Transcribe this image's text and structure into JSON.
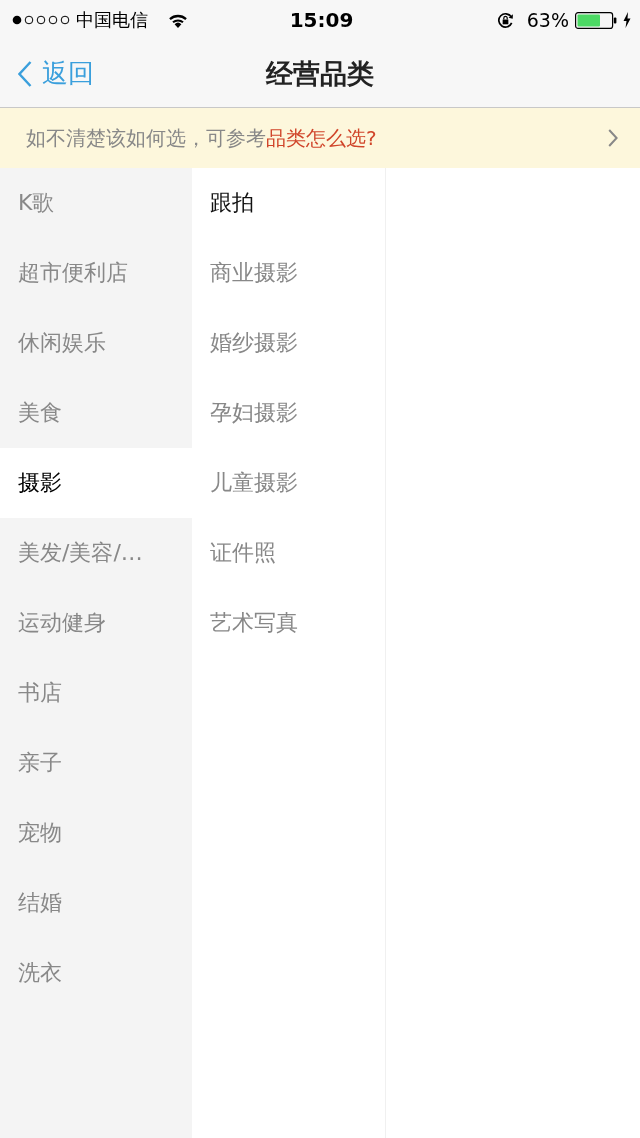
{
  "status_bar": {
    "carrier": "中国电信",
    "time": "15:09",
    "battery_percent": "63%"
  },
  "nav_bar": {
    "back_label": "返回",
    "title": "经营品类"
  },
  "notice": {
    "text": "如不清楚该如何选，可参考",
    "link": "品类怎么选?"
  },
  "categories": [
    {
      "label": "K歌",
      "selected": false
    },
    {
      "label": "超市便利店",
      "selected": false
    },
    {
      "label": "休闲娱乐",
      "selected": false
    },
    {
      "label": "美食",
      "selected": false
    },
    {
      "label": "摄影",
      "selected": true
    },
    {
      "label": "美发/美容/…",
      "selected": false
    },
    {
      "label": "运动健身",
      "selected": false
    },
    {
      "label": "书店",
      "selected": false
    },
    {
      "label": "亲子",
      "selected": false
    },
    {
      "label": "宠物",
      "selected": false
    },
    {
      "label": "结婚",
      "selected": false
    },
    {
      "label": "洗衣",
      "selected": false
    }
  ],
  "subcategories": [
    {
      "label": "跟拍",
      "selected": true
    },
    {
      "label": "商业摄影",
      "selected": false
    },
    {
      "label": "婚纱摄影",
      "selected": false
    },
    {
      "label": "孕妇摄影",
      "selected": false
    },
    {
      "label": "儿童摄影",
      "selected": false
    },
    {
      "label": "证件照",
      "selected": false
    },
    {
      "label": "艺术写真",
      "selected": false
    }
  ]
}
